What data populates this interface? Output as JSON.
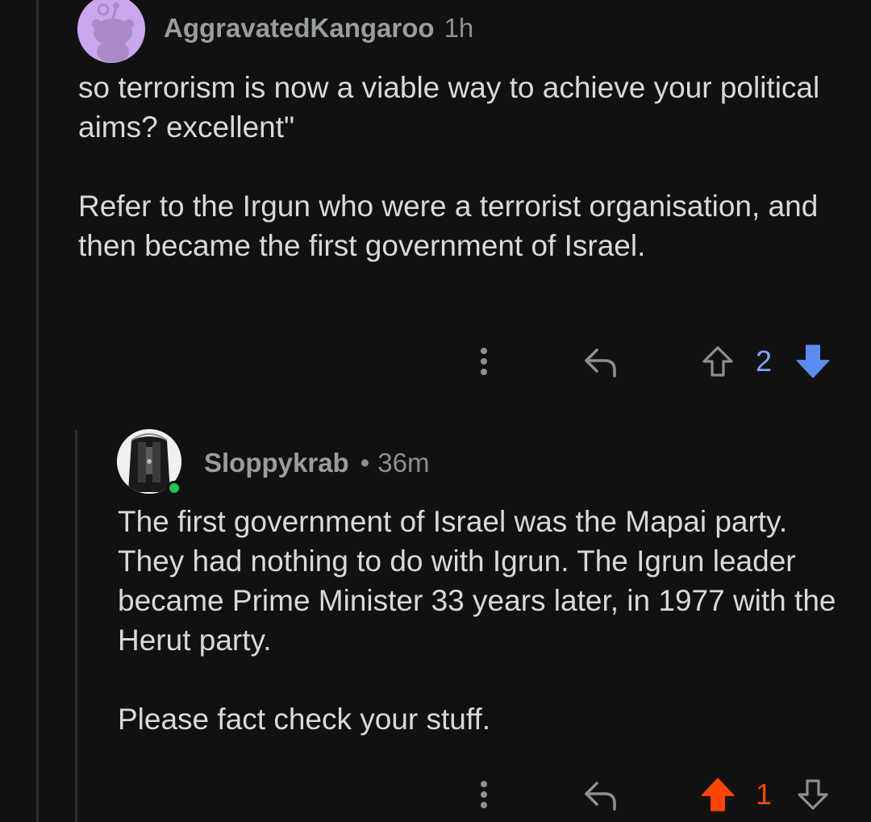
{
  "comments": [
    {
      "username": "AggravatedKangaroo",
      "time": "1h",
      "paragraphs": [
        "so terrorism is now a viable way to achieve your political aims? excellent\"",
        "Refer to the Irgun who were a terrorist organisation, and then became the first government of Israel."
      ],
      "score": "2",
      "vote_state": "downvoted",
      "icons": {
        "more": "more-vertical-icon",
        "reply": "reply-arrow-icon",
        "upvote": "upvote-outline-icon",
        "downvote": "downvote-filled-icon"
      }
    },
    {
      "username": "Sloppykrab",
      "separator": "•",
      "time": "36m",
      "online": true,
      "paragraphs": [
        "The first government of Israel was the Mapai party. They had nothing to do with Igrun. The Igrun leader became Prime Minister 33 years later, in 1977 with the Herut party.",
        "Please fact check your stuff."
      ],
      "score": "1",
      "vote_state": "upvoted",
      "icons": {
        "more": "more-vertical-icon",
        "reply": "reply-arrow-icon",
        "upvote": "upvote-filled-icon",
        "downvote": "downvote-outline-icon"
      }
    }
  ],
  "colors": {
    "background": "#111111",
    "text": "#d7dadc",
    "muted": "#8d9093",
    "downvote_blue": "#7fa3f5",
    "upvote_orange": "#ff4500",
    "online_green": "#1fc457",
    "avatar_purple": "#c9a7ea"
  }
}
